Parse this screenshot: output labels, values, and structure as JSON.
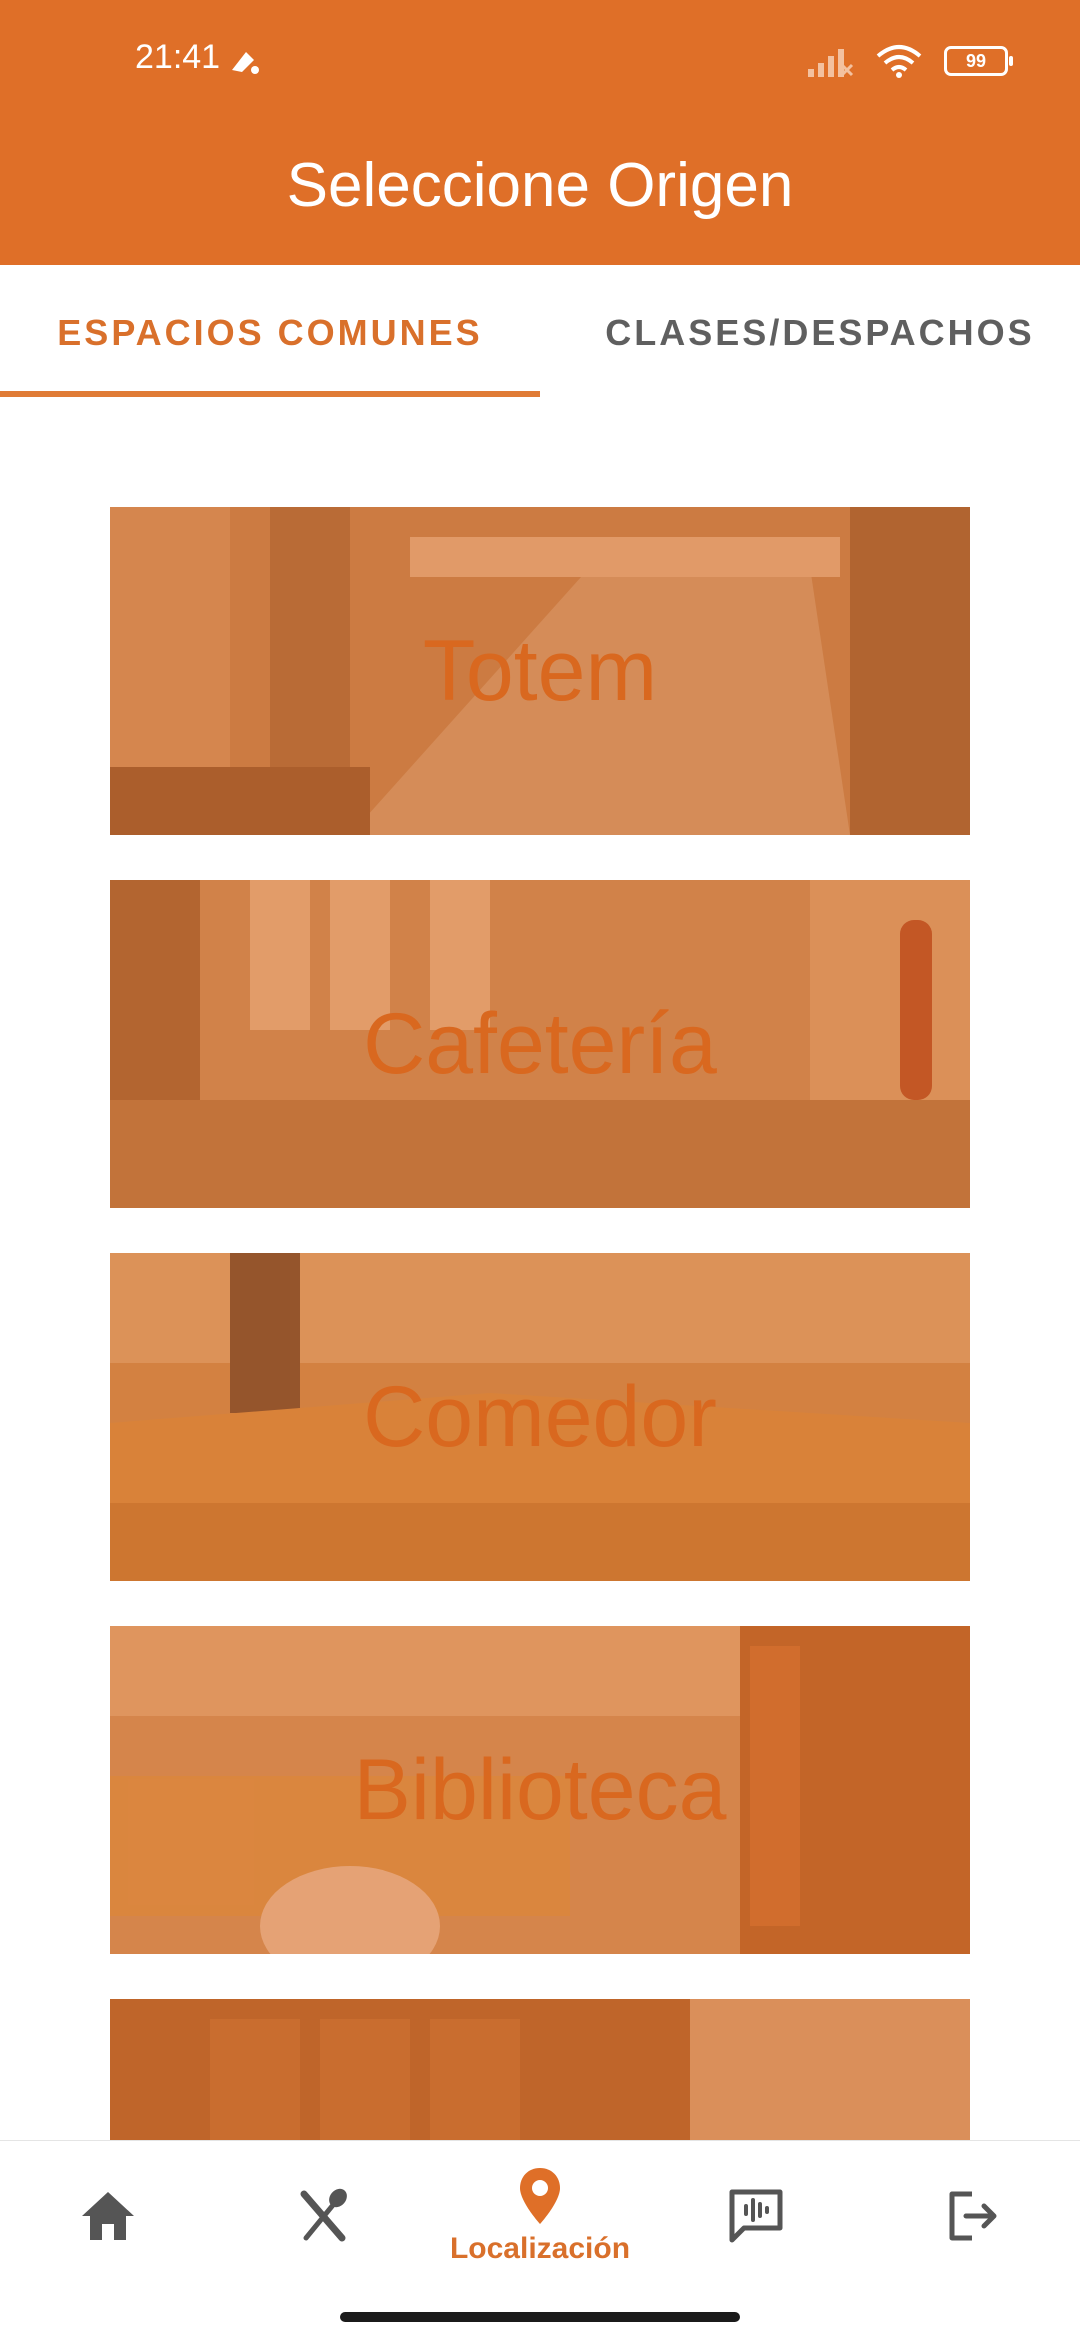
{
  "status_bar": {
    "time": "21:41",
    "battery": "99"
  },
  "app_bar": {
    "title": "Seleccione Origen"
  },
  "tabs": [
    {
      "label": "ESPACIOS COMUNES",
      "active": true
    },
    {
      "label": "CLASES/DESPACHOS",
      "active": false
    }
  ],
  "cards": [
    {
      "label": "Totem"
    },
    {
      "label": "Cafetería"
    },
    {
      "label": "Comedor"
    },
    {
      "label": "Biblioteca"
    },
    {
      "label": ""
    }
  ],
  "bottom_nav": {
    "items": [
      {
        "icon": "home-icon"
      },
      {
        "icon": "fork-knife-icon"
      },
      {
        "icon": "location-pin-icon",
        "label": "Localización"
      },
      {
        "icon": "message-audio-icon"
      },
      {
        "icon": "logout-icon"
      }
    ]
  },
  "colors": {
    "brand": "#df6f28",
    "active_text": "#d9702b",
    "inactive_text": "#5f5f5f"
  }
}
